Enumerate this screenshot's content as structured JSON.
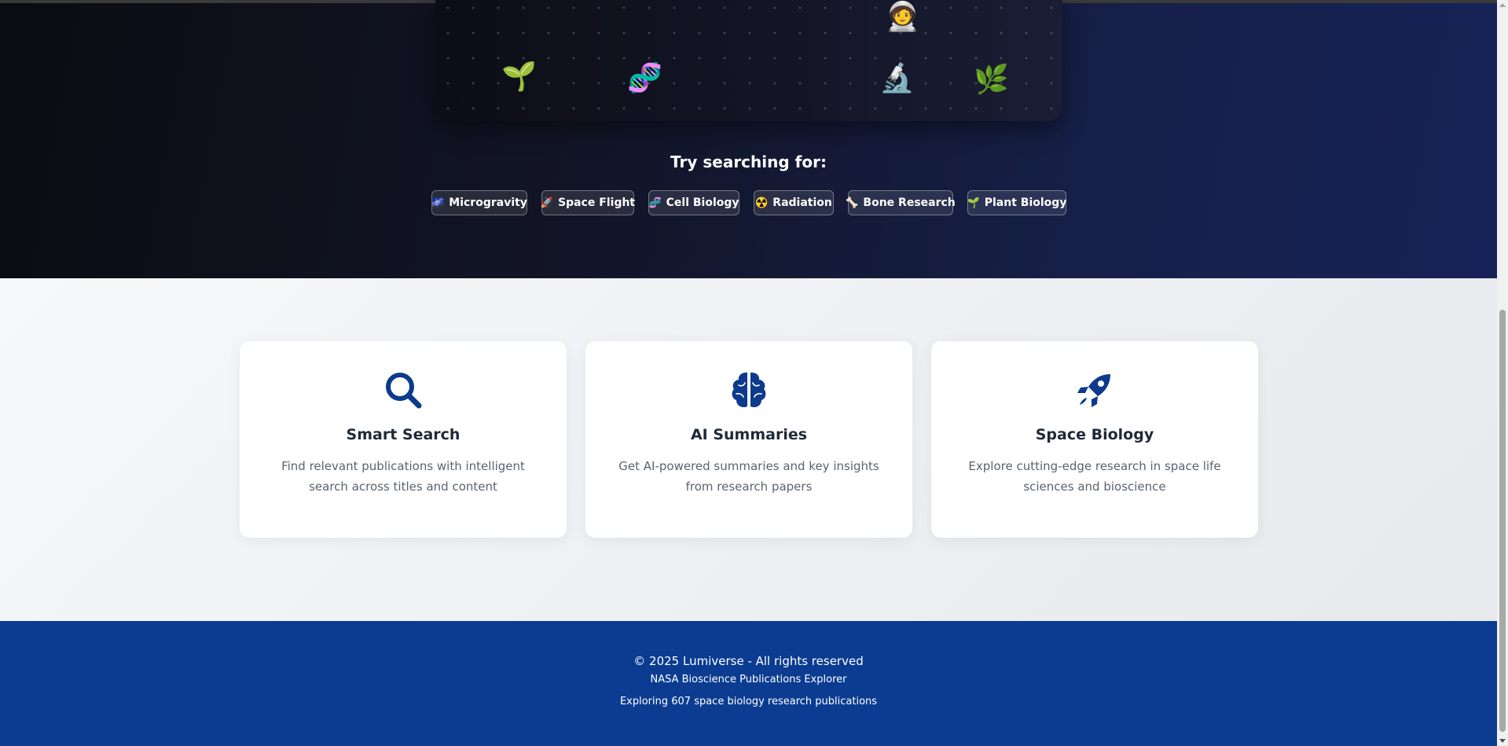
{
  "hero": {
    "emojis": {
      "plant": "🌱",
      "dna": "🧬",
      "astronaut": "🧑‍🚀",
      "microscope": "🔬",
      "leaf": "🌿"
    },
    "try_title": "Try searching for:",
    "chips": [
      {
        "icon": "🌌",
        "label": "Microgravity"
      },
      {
        "icon": "🚀",
        "label": "Space Flight"
      },
      {
        "icon": "🧬",
        "label": "Cell Biology"
      },
      {
        "icon": "☢️",
        "label": "Radiation"
      },
      {
        "icon": "🦴",
        "label": "Bone Research"
      },
      {
        "icon": "🌱",
        "label": "Plant Biology"
      }
    ]
  },
  "features": [
    {
      "icon": "search-icon",
      "title": "Smart Search",
      "description": "Find relevant publications with intelligent search across titles and content"
    },
    {
      "icon": "brain-icon",
      "title": "AI Summaries",
      "description": "Get AI-powered summaries and key insights from research papers"
    },
    {
      "icon": "rocket-icon",
      "title": "Space Biology",
      "description": "Explore cutting-edge research in space life sciences and bioscience"
    }
  ],
  "footer": {
    "copyright": "© 2025 Lumiverse - All rights reserved",
    "subtitle": "NASA Bioscience Publications Explorer",
    "stats": "Exploring 607 space biology research publications"
  },
  "colors": {
    "accent": "#0b3c91",
    "icon": "#0d3a8c"
  }
}
